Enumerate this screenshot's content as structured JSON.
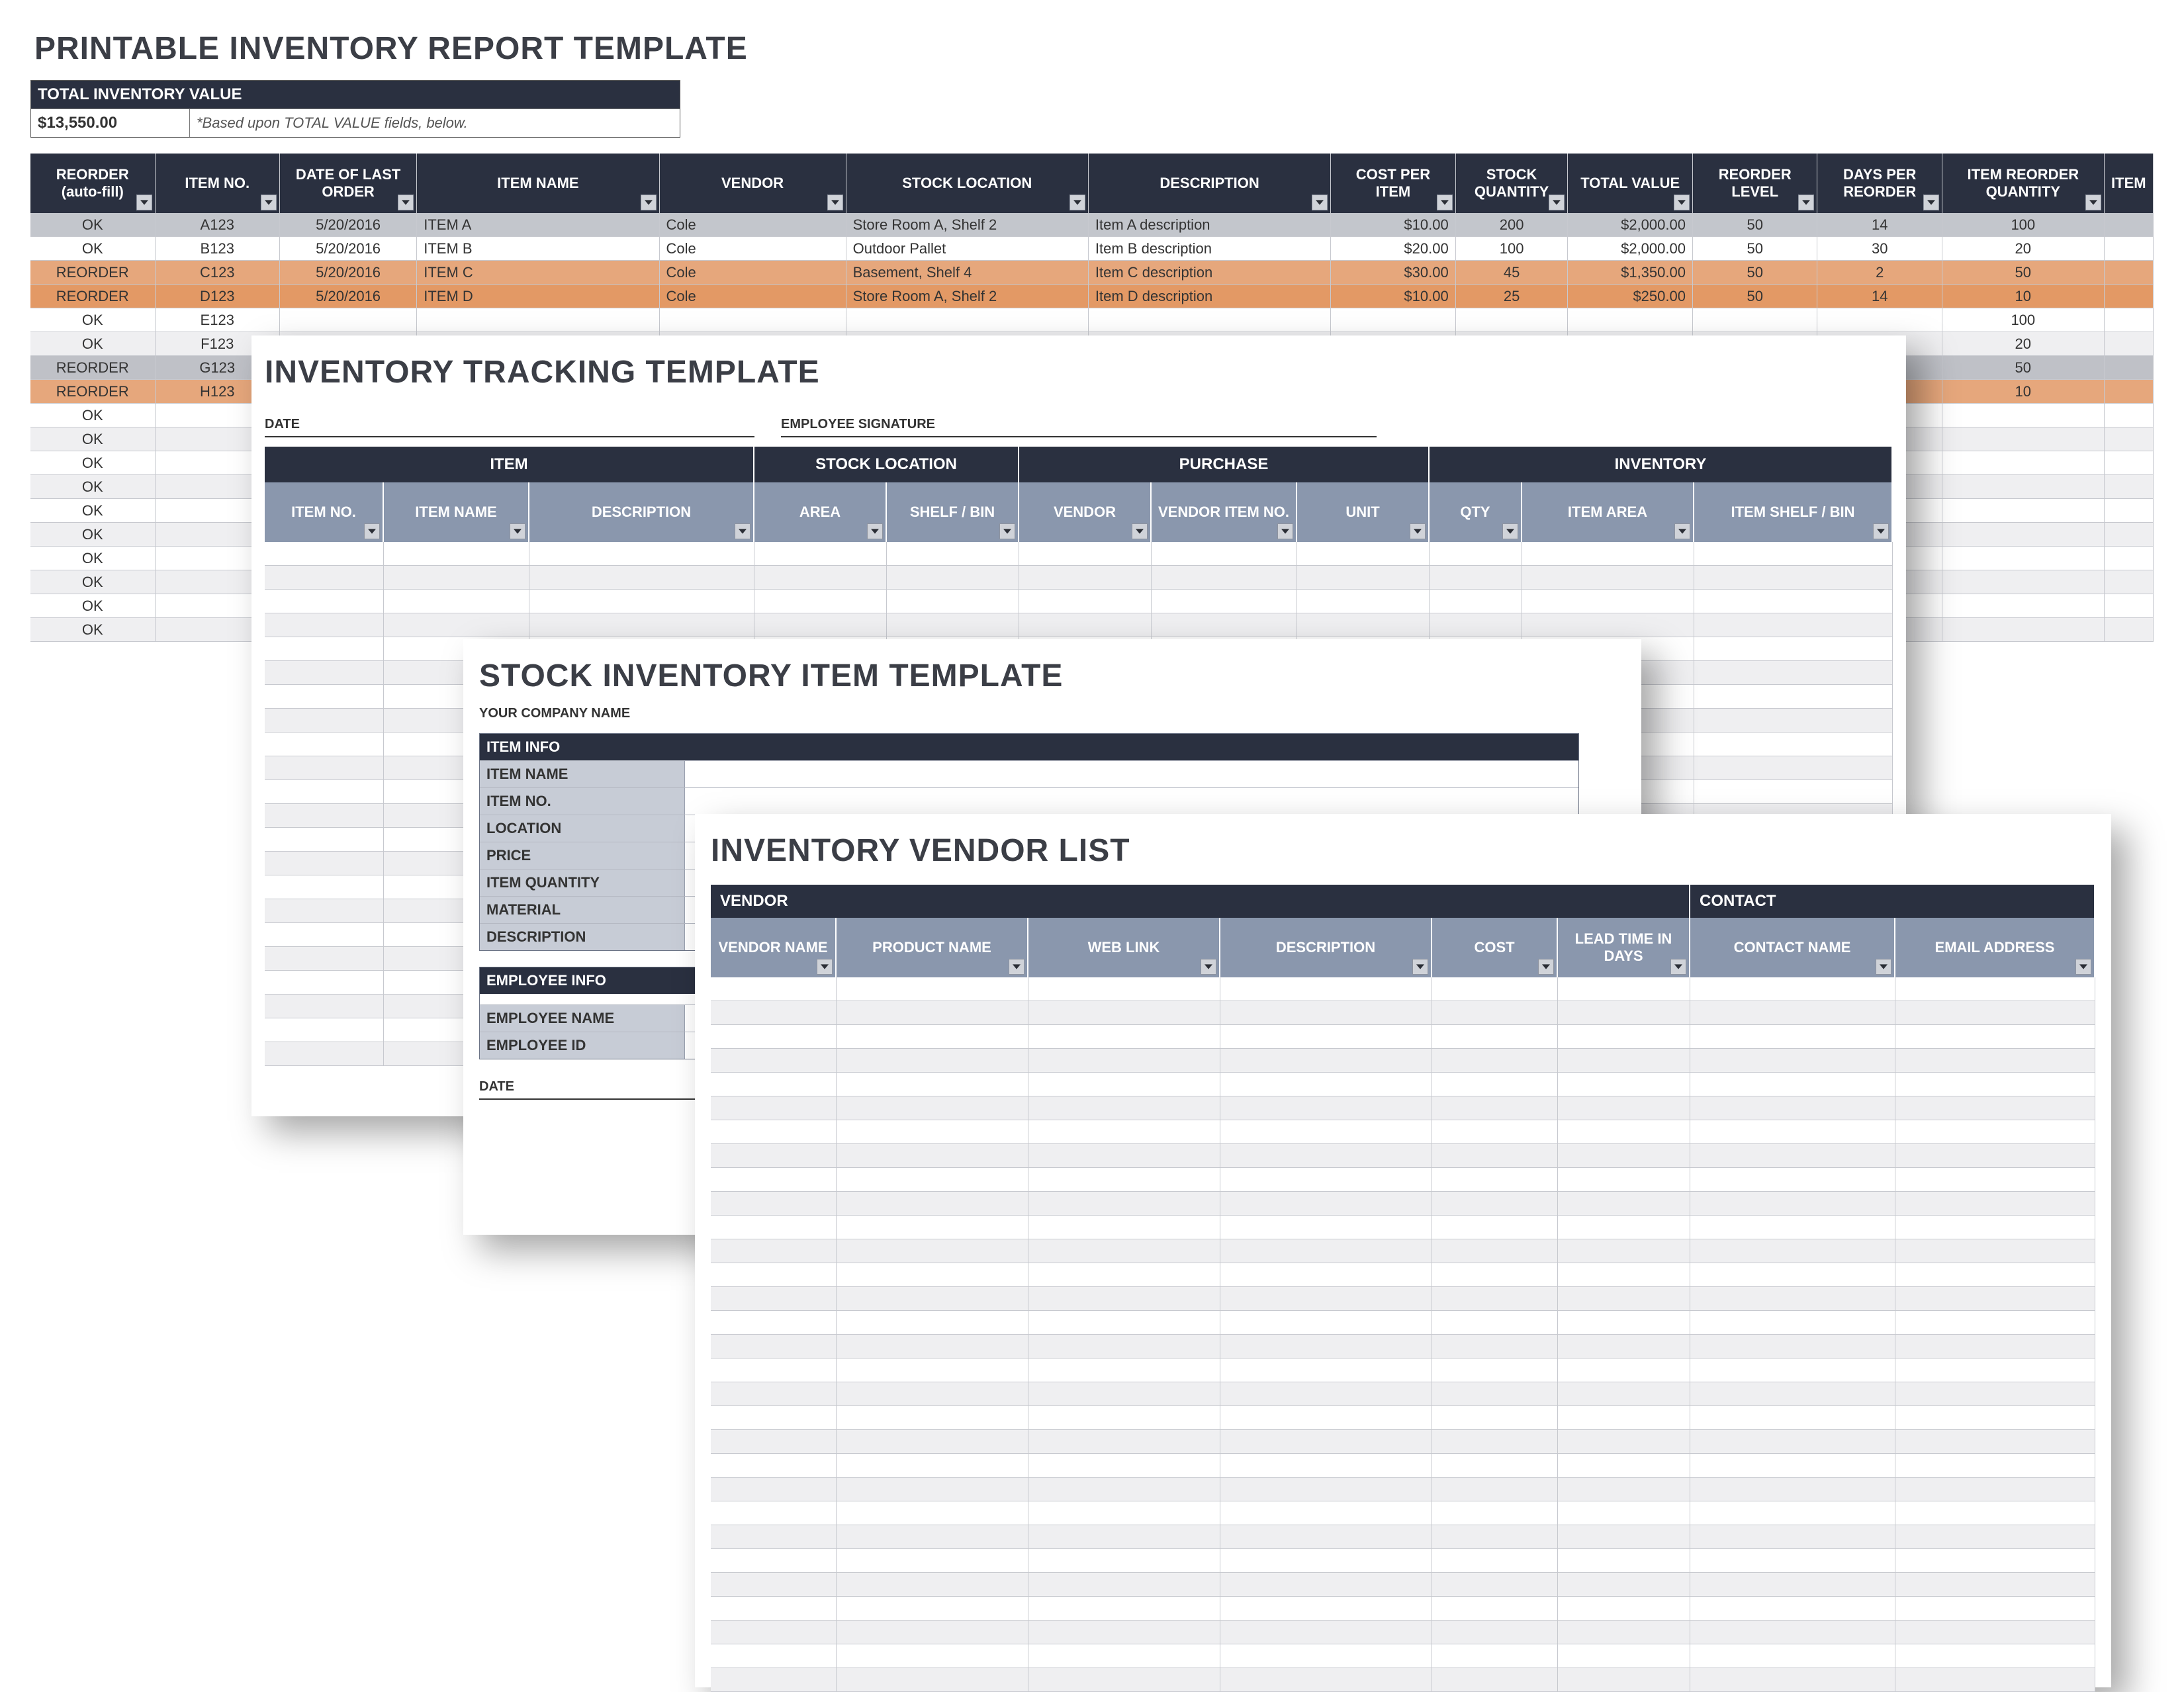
{
  "report": {
    "title": "PRINTABLE INVENTORY REPORT TEMPLATE",
    "total_box_label": "TOTAL INVENTORY VALUE",
    "total_value": "$13,550.00",
    "note": "*Based upon TOTAL VALUE fields, below.",
    "columns": [
      "REORDER (auto-fill)",
      "ITEM NO.",
      "DATE OF LAST ORDER",
      "ITEM NAME",
      "VENDOR",
      "STOCK LOCATION",
      "DESCRIPTION",
      "COST PER ITEM",
      "STOCK QUANTITY",
      "TOTAL VALUE",
      "REORDER LEVEL",
      "DAYS PER REORDER",
      "ITEM REORDER QUANTITY",
      "ITEM"
    ],
    "rows": [
      {
        "r": "OK",
        "no": "A123",
        "date": "5/20/2016",
        "name": "ITEM A",
        "vendor": "Cole",
        "loc": "Store Room A, Shelf 2",
        "desc": "Item A description",
        "cost": "$10.00",
        "qty": "200",
        "total": "$2,000.00",
        "rl": "50",
        "dpr": "14",
        "irq": "100"
      },
      {
        "r": "OK",
        "no": "B123",
        "date": "5/20/2016",
        "name": "ITEM B",
        "vendor": "Cole",
        "loc": "Outdoor Pallet",
        "desc": "Item B description",
        "cost": "$20.00",
        "qty": "100",
        "total": "$2,000.00",
        "rl": "50",
        "dpr": "30",
        "irq": "20"
      },
      {
        "r": "REORDER",
        "no": "C123",
        "date": "5/20/2016",
        "name": "ITEM C",
        "vendor": "Cole",
        "loc": "Basement, Shelf 4",
        "desc": "Item C description",
        "cost": "$30.00",
        "qty": "45",
        "total": "$1,350.00",
        "rl": "50",
        "dpr": "2",
        "irq": "50"
      },
      {
        "r": "REORDER",
        "no": "D123",
        "date": "5/20/2016",
        "name": "ITEM D",
        "vendor": "Cole",
        "loc": "Store Room A, Shelf 2",
        "desc": "Item D description",
        "cost": "$10.00",
        "qty": "25",
        "total": "$250.00",
        "rl": "50",
        "dpr": "14",
        "irq": "10"
      }
    ],
    "tail": [
      {
        "r": "OK",
        "no": "E123",
        "irq": "100"
      },
      {
        "r": "OK",
        "no": "F123",
        "irq": "20"
      },
      {
        "r": "REORDER",
        "no": "G123",
        "irq": "50",
        "sel": true
      },
      {
        "r": "REORDER",
        "no": "H123",
        "irq": "10",
        "orange": true
      },
      {
        "r": "OK"
      },
      {
        "r": "OK"
      },
      {
        "r": "OK"
      },
      {
        "r": "OK"
      },
      {
        "r": "OK"
      },
      {
        "r": "OK"
      },
      {
        "r": "OK"
      },
      {
        "r": "OK"
      },
      {
        "r": "OK"
      },
      {
        "r": "OK"
      }
    ]
  },
  "tracking": {
    "title": "INVENTORY TRACKING TEMPLATE",
    "date_label": "DATE",
    "sig_label": "EMPLOYEE SIGNATURE",
    "groups": [
      "ITEM",
      "STOCK LOCATION",
      "PURCHASE",
      "INVENTORY"
    ],
    "columns": [
      "ITEM NO.",
      "ITEM NAME",
      "DESCRIPTION",
      "AREA",
      "SHELF / BIN",
      "VENDOR",
      "VENDOR ITEM NO.",
      "UNIT",
      "QTY",
      "ITEM AREA",
      "ITEM SHELF / BIN"
    ]
  },
  "stock": {
    "title": "STOCK INVENTORY ITEM TEMPLATE",
    "subtitle": "YOUR COMPANY NAME",
    "item_info_header": "ITEM INFO",
    "item_fields": [
      "ITEM NAME",
      "ITEM NO.",
      "LOCATION",
      "PRICE",
      "ITEM QUANTITY",
      "MATERIAL",
      "DESCRIPTION"
    ],
    "employee_info_header": "EMPLOYEE INFO",
    "employee_fields": [
      "EMPLOYEE NAME",
      "EMPLOYEE ID"
    ],
    "date_label": "DATE"
  },
  "vendor": {
    "title": "INVENTORY VENDOR LIST",
    "groups": [
      "VENDOR",
      "CONTACT"
    ],
    "columns": [
      "VENDOR NAME",
      "PRODUCT NAME",
      "WEB LINK",
      "DESCRIPTION",
      "COST",
      "LEAD TIME IN DAYS",
      "CONTACT NAME",
      "EMAIL ADDRESS"
    ]
  }
}
